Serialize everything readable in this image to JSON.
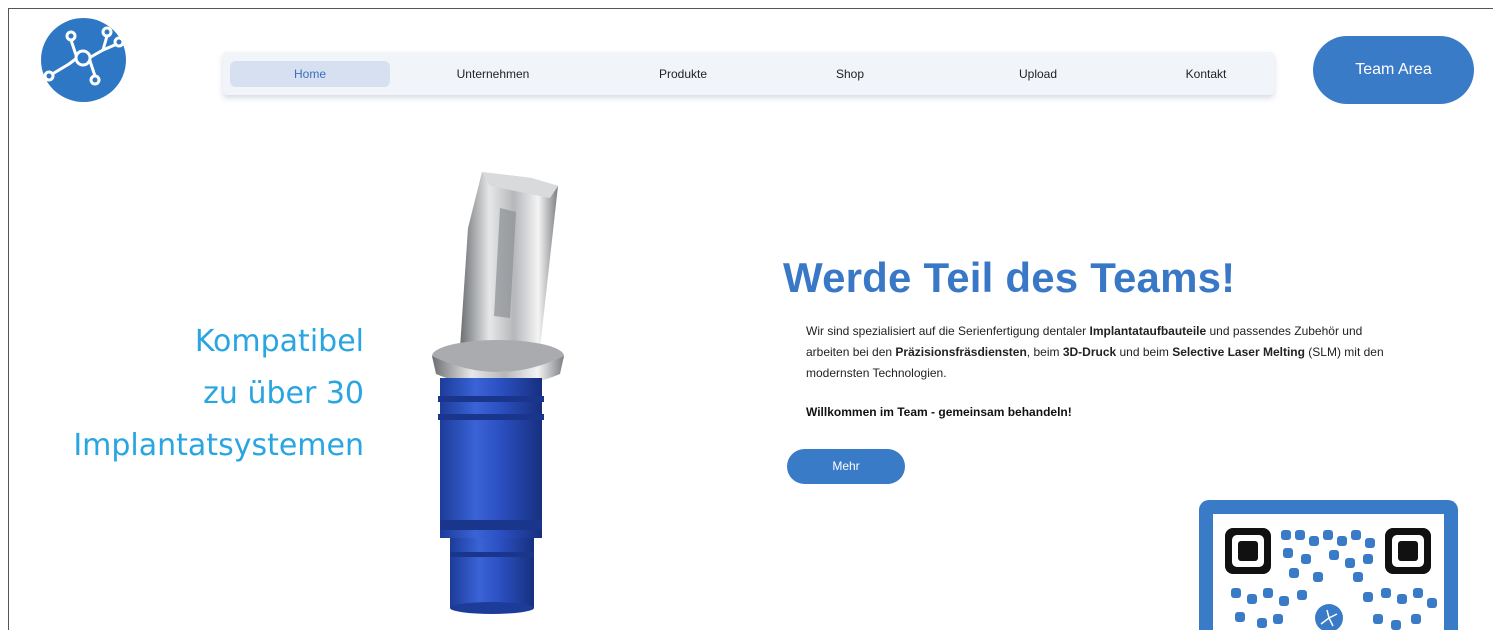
{
  "colors": {
    "brand_blue": "#3a7bc8",
    "light_blue_text": "#29a6e2",
    "nav_bg": "#f1f4f9",
    "nav_active_bg": "#d6e0f0"
  },
  "logo": {
    "icon": "molecule-network-icon"
  },
  "nav": {
    "items": [
      {
        "label": "Home",
        "active": true
      },
      {
        "label": "Unternehmen"
      },
      {
        "label": "Produkte"
      },
      {
        "label": "Shop"
      },
      {
        "label": "Upload"
      },
      {
        "label": "Kontakt"
      }
    ]
  },
  "team_area_label": "Team Area",
  "hero": {
    "tagline_line1": "Kompatibel",
    "tagline_line2": "zu über 30",
    "tagline_line3": "Implantatsystemen",
    "product_image": "dental-abutment-image"
  },
  "intro": {
    "headline": "Werde Teil des Teams!",
    "p_1": "Wir sind spezialisiert auf die Serienfertigung dentaler ",
    "p_2": "Implantataufbauteile",
    "p_3": " und passendes Zubehör und arbeiten bei den ",
    "p_4": "Präzisionsfräsdiensten",
    "p_5": ", beim ",
    "p_6": "3D-Druck",
    "p_7": " und beim ",
    "p_8": "Selective Laser Melting",
    "p_9": " (SLM) mit den modernsten Technologien.",
    "welcome": "Willkommen im Team - gemeinsam behandeln!",
    "more_label": "Mehr"
  },
  "qr": {
    "icon": "qr-code-icon"
  }
}
